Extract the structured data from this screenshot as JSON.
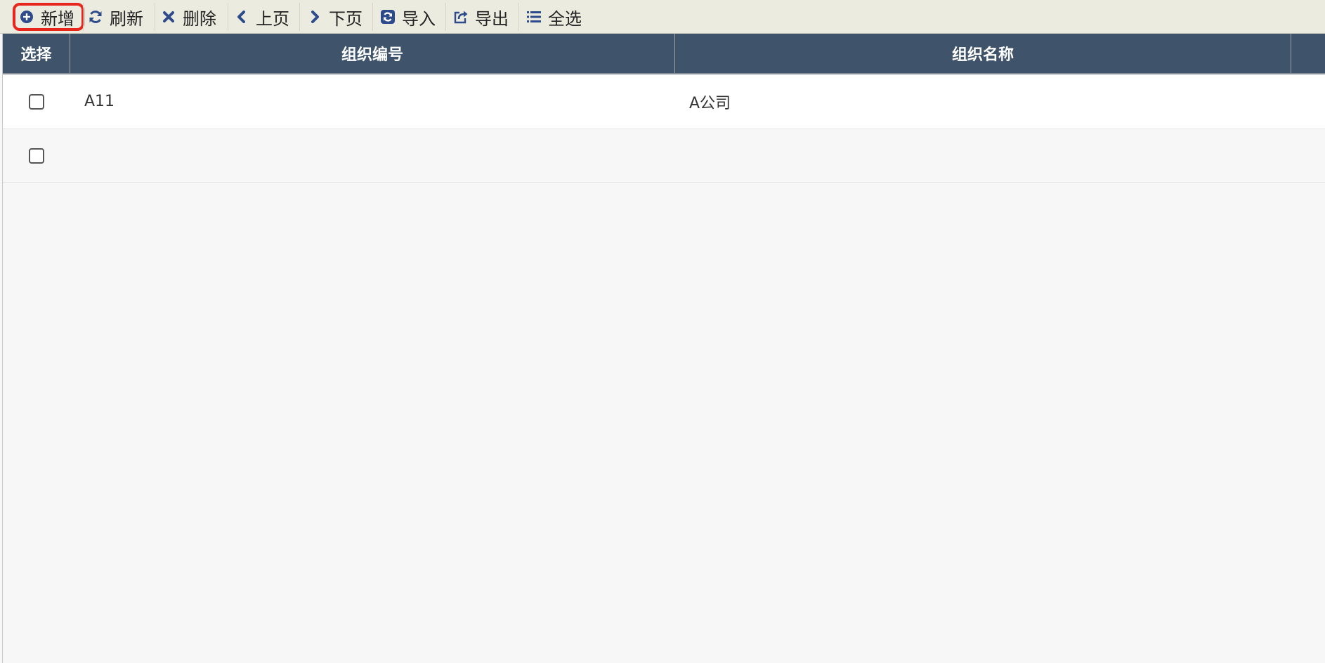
{
  "toolbar": {
    "buttons": [
      {
        "label": "新增",
        "icon": "plus-circle-icon"
      },
      {
        "label": "刷新",
        "icon": "refresh-icon"
      },
      {
        "label": "删除",
        "icon": "close-icon"
      },
      {
        "label": "上页",
        "icon": "chevron-left-icon"
      },
      {
        "label": "下页",
        "icon": "chevron-right-icon"
      },
      {
        "label": "导入",
        "icon": "import-icon"
      },
      {
        "label": "导出",
        "icon": "export-icon"
      },
      {
        "label": "全选",
        "icon": "list-icon"
      }
    ],
    "highlight_color": "#e8261e",
    "icon_color": "#2d4a8a"
  },
  "table": {
    "columns": [
      "选择",
      "组织编号",
      "组织名称"
    ],
    "rows": [
      {
        "code": "A11",
        "name": "A公司"
      },
      {
        "code": "",
        "name": ""
      }
    ],
    "header_bg": "#3f546a"
  }
}
